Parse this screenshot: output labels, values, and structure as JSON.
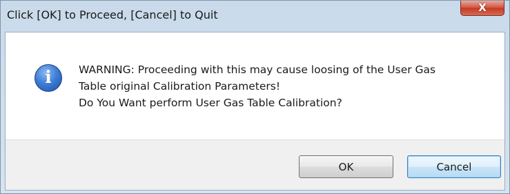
{
  "window": {
    "title": "Click [OK] to Proceed, [Cancel] to Quit",
    "close_label": "X"
  },
  "dialog": {
    "icon": "information-icon",
    "icon_glyph": "i",
    "message_lines": [
      "WARNING: Proceeding with this may cause loosing of the User Gas",
      "Table original Calibration Parameters!",
      "Do You Want perform User Gas Table Calibration?"
    ]
  },
  "buttons": {
    "ok_label": "OK",
    "cancel_label": "Cancel"
  },
  "colors": {
    "title_bar": "#c9daea",
    "close_button": "#c23a24",
    "info_icon": "#3f7fd6",
    "footer": "#f0f0f0",
    "focused_button_border": "#3c7fb1"
  }
}
